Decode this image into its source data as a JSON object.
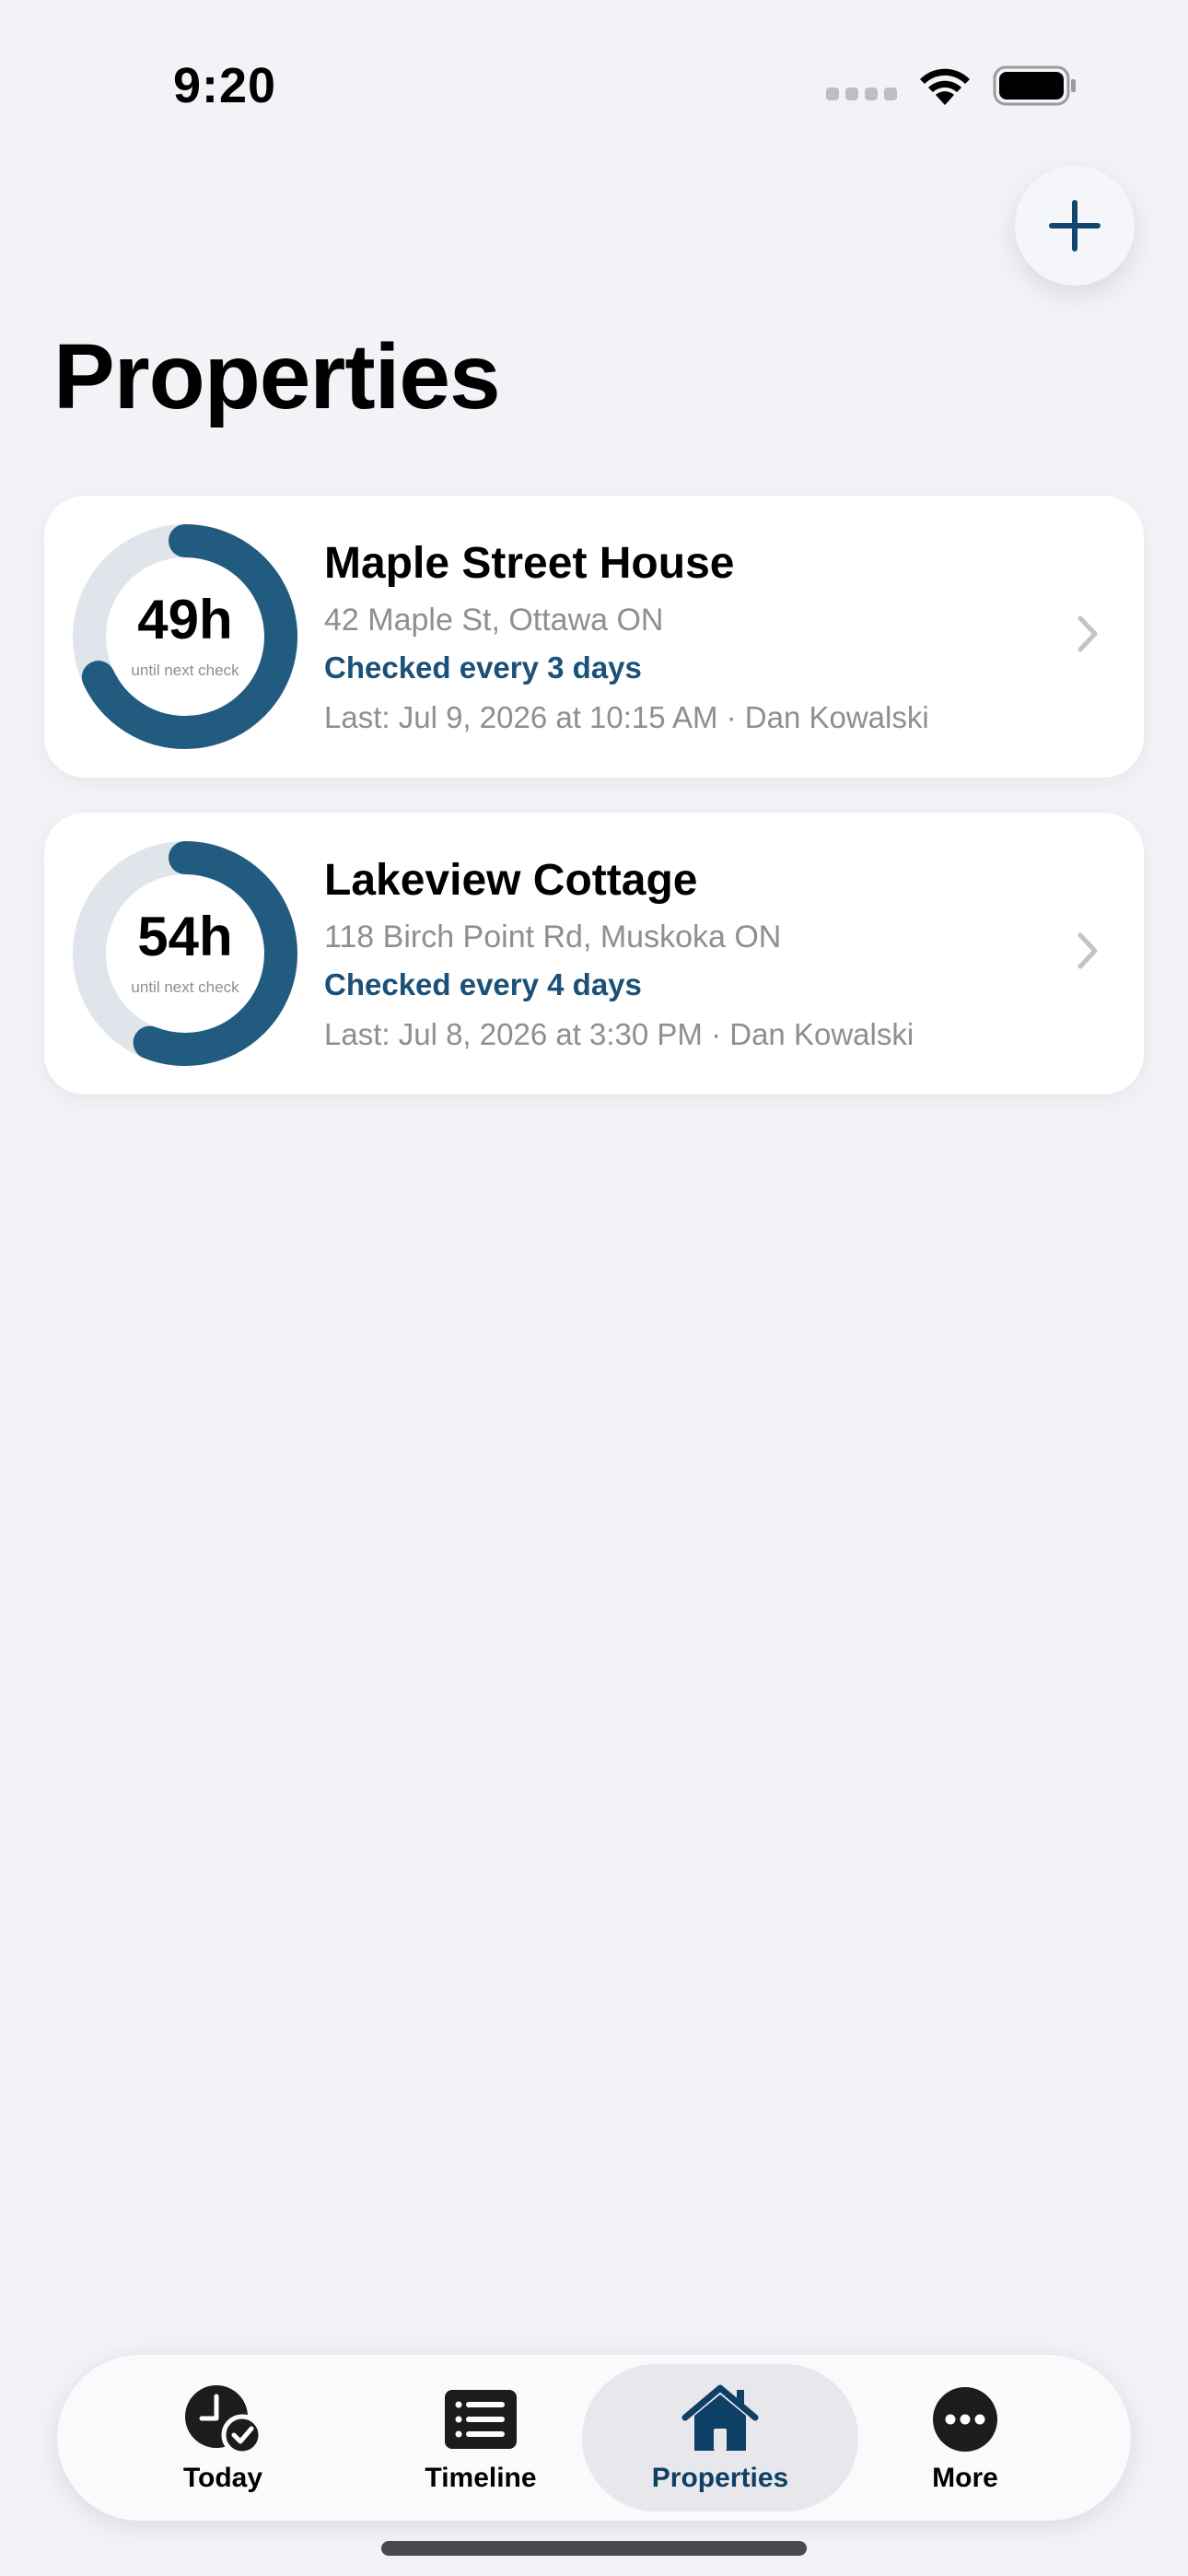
{
  "status_bar": {
    "time": "9:20"
  },
  "header": {
    "title": "Properties"
  },
  "properties": [
    {
      "hours": "49h",
      "caption": "until next check",
      "progress": 0.68,
      "name": "Maple Street House",
      "address": "42 Maple St, Ottawa ON",
      "frequency": "Checked every 3 days",
      "last": "Last: Jul 9, 2026 at 10:15 AM · Dan Kowalski"
    },
    {
      "hours": "54h",
      "caption": "until next check",
      "progress": 0.56,
      "name": "Lakeview Cottage",
      "address": "118 Birch Point Rd, Muskoka ON",
      "frequency": "Checked every 4 days",
      "last": "Last: Jul 8, 2026 at 3:30 PM · Dan Kowalski"
    }
  ],
  "tabs": [
    {
      "label": "Today",
      "icon": "clock-check-icon"
    },
    {
      "label": "Timeline",
      "icon": "list-icon"
    },
    {
      "label": "Properties",
      "icon": "house-icon",
      "active": true
    },
    {
      "label": "More",
      "icon": "ellipsis-icon"
    }
  ],
  "colors": {
    "accent": "#1B5078",
    "ring_track": "#DFE5EA",
    "ring_fill": "#225B80",
    "background": "#F2F2F7"
  }
}
